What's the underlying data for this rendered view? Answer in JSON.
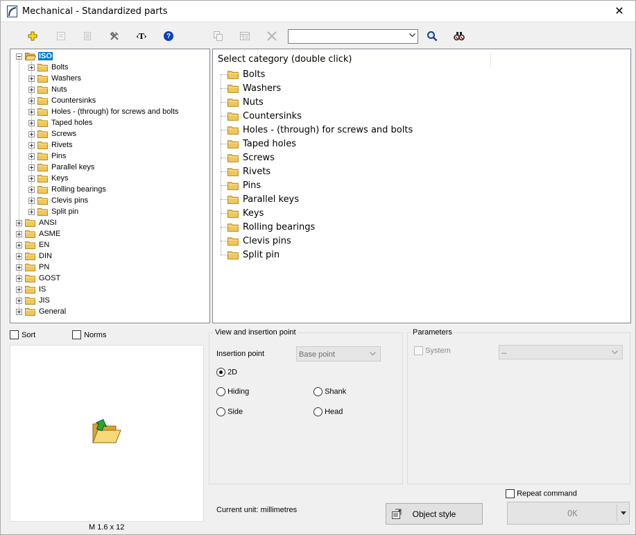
{
  "window": {
    "title": "Mechanical - Standardized parts",
    "close_glyph": "✕"
  },
  "toolbar": {
    "buttons": [
      {
        "name": "add-icon",
        "enabled": true
      },
      {
        "name": "edit-icon",
        "enabled": false
      },
      {
        "name": "properties-icon",
        "enabled": false
      },
      {
        "name": "tools-icon",
        "enabled": true
      },
      {
        "name": "text-tag-icon",
        "enabled": true,
        "glyph": "‹T›"
      },
      {
        "name": "help-icon",
        "enabled": true,
        "glyph": "?"
      },
      {
        "name": "copy-icon",
        "enabled": false
      },
      {
        "name": "table-icon",
        "enabled": false
      },
      {
        "name": "delete-icon",
        "enabled": false
      },
      {
        "name": "search-icon",
        "enabled": true
      },
      {
        "name": "find-part-icon",
        "enabled": true
      }
    ],
    "search_value": ""
  },
  "tree": {
    "root": "ISO",
    "children": [
      "Bolts",
      "Washers",
      "Nuts",
      "Countersinks",
      "Holes - (through) for screws and bolts",
      "Taped holes",
      "Screws",
      "Rivets",
      "Pins",
      "Parallel keys",
      "Keys",
      "Rolling bearings",
      "Clevis pins",
      "Split pin"
    ],
    "standards": [
      "ANSI",
      "ASME",
      "EN",
      "DIN",
      "PN",
      "GOST",
      "IS",
      "JIS",
      "General"
    ]
  },
  "category_panel": {
    "header": "Select category (double click)",
    "items": [
      "Bolts",
      "Washers",
      "Nuts",
      "Countersinks",
      "Holes - (through) for screws and bolts",
      "Taped holes",
      "Screws",
      "Rivets",
      "Pins",
      "Parallel keys",
      "Keys",
      "Rolling bearings",
      "Clevis pins",
      "Split pin"
    ]
  },
  "options": {
    "sort_label": "Sort",
    "sort_checked": false,
    "norms_label": "Norms",
    "norms_checked": false
  },
  "preview": {
    "caption": "M 1.6 x 12",
    "icon": "folder-open-arrow-icon"
  },
  "view": {
    "group_title": "View and insertion point",
    "insertion_label": "Insertion point",
    "insertion_value": "Base point",
    "radios": {
      "r2d": "2D",
      "hiding": "Hiding",
      "shank": "Shank",
      "side": "Side",
      "head": "Head"
    },
    "selected": "2D"
  },
  "parameters": {
    "group_title": "Parameters",
    "system_label": "System",
    "system_value": "--"
  },
  "footer": {
    "current_unit": "Current unit: millimetres",
    "repeat_label": "Repeat command",
    "object_style_label": "Object style",
    "ok_label": "OK"
  },
  "colors": {
    "selection": "#0078d7",
    "folder": "#f1c75a"
  }
}
